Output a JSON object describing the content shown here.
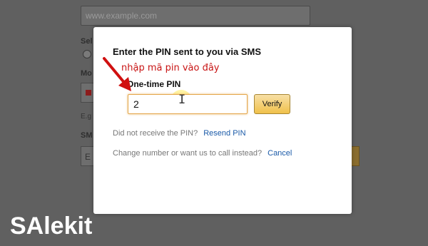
{
  "background": {
    "email_placeholder": "www.example.com",
    "label_sel": "Sel",
    "label_mo": "Mo",
    "hint_eg": "E.g",
    "label_sm": "SM",
    "select_value": "E"
  },
  "modal": {
    "title": "Enter the PIN sent to you via SMS",
    "annotation": "nhập mã pin vào đây",
    "pin_label": "One-time PIN",
    "pin_value": "2",
    "verify_label": "Verify",
    "not_received_text": "Did not receive the PIN?",
    "resend_link": "Resend PIN",
    "change_text": "Change number or want us to call instead?",
    "cancel_link": "Cancel"
  },
  "watermark": "SAlekit",
  "colors": {
    "annotation": "#c81414",
    "link": "#1a5aa8",
    "verify_button": "#f0c14b",
    "input_focus_border": "#e4a64a"
  },
  "icons": [
    "red-arrow-icon",
    "text-cursor-icon"
  ]
}
